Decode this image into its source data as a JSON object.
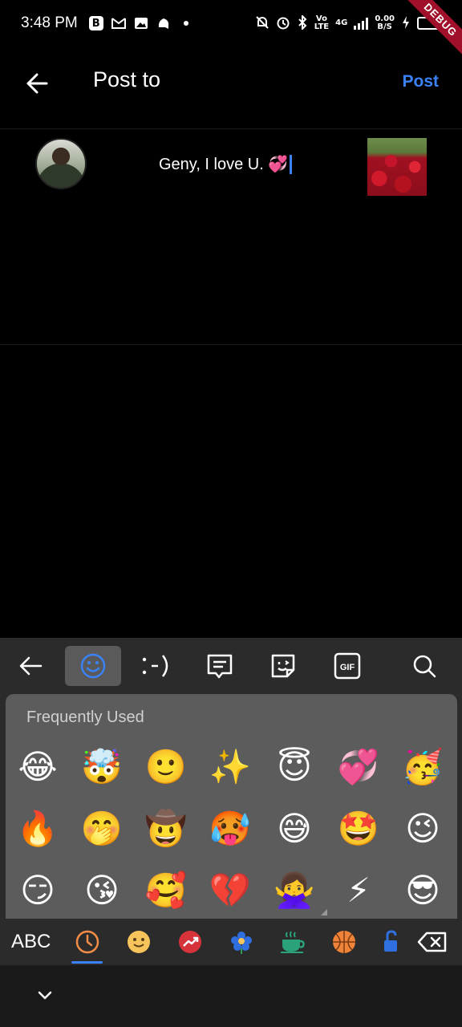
{
  "status_bar": {
    "time": "3:48 PM",
    "left_icons": [
      "b-icon",
      "gmail-icon",
      "photos-icon",
      "notification-icon"
    ],
    "net_top": "Vo",
    "net_bottom": "LTE",
    "gen_top": "4G",
    "speed_top": "0.00",
    "speed_bottom": "B/S",
    "debug_label": "DEBUG"
  },
  "header": {
    "title": "Post to",
    "post_label": "Post"
  },
  "composer": {
    "caption": "Geny, I love U. 💞"
  },
  "emoji_panel": {
    "toolbar_icons": [
      "back-arrow-icon",
      "smiley-icon",
      "emoticon-icon",
      "message-icon",
      "sticker-icon",
      "gif-icon",
      "search-icon"
    ],
    "gif_label": "GIF",
    "section_title": "Frequently Used",
    "emojis": [
      "😂",
      "🤯",
      "🙂",
      "✨",
      "😇",
      "💞",
      "🥳",
      "🔥",
      "🤭",
      "🤠",
      "🥵",
      "😅",
      "🤩",
      "😉",
      "😏",
      "😘",
      "🥰",
      "💔",
      "🙅‍♀️",
      "⚡",
      "😎"
    ],
    "categories": {
      "abc_label": "ABC",
      "icons": [
        "recent-clock-icon",
        "smileys-icon",
        "trending-icon",
        "nature-flower-icon",
        "food-cup-icon",
        "sports-ball-icon",
        "objects-icon",
        "backspace-icon"
      ]
    },
    "accent_color": "#3b82f6"
  }
}
